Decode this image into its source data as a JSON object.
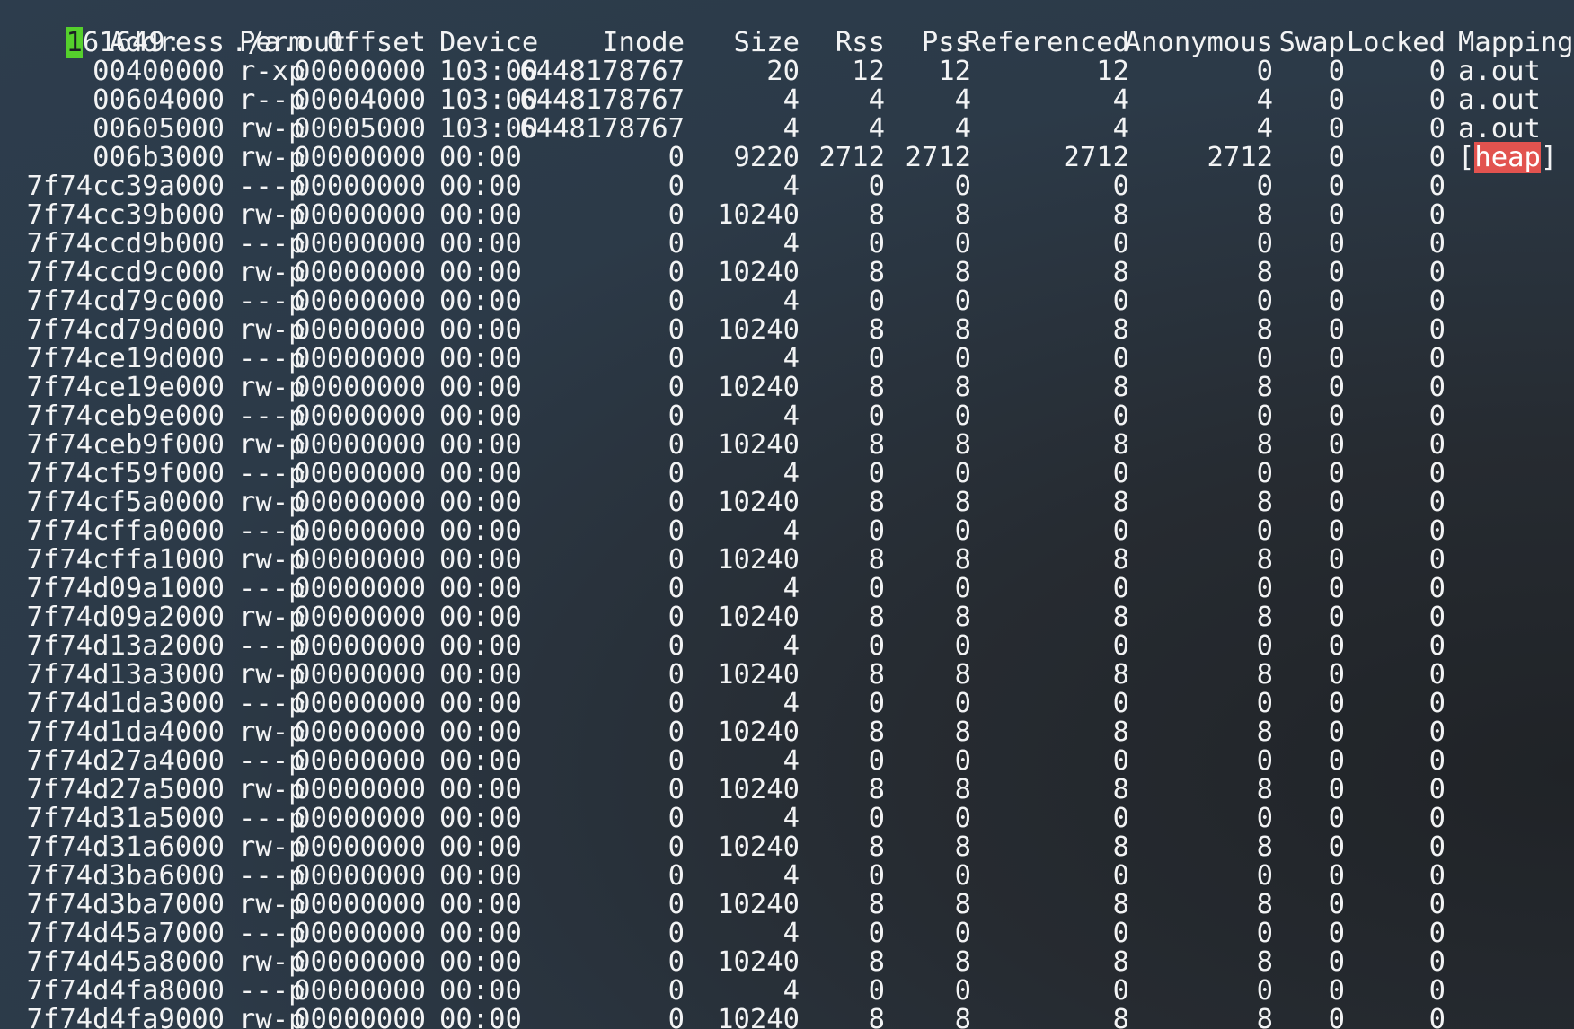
{
  "title_line": {
    "cursor_char": "1",
    "pid_rest": "61649:",
    "command": "./a.out"
  },
  "headers": [
    "Address",
    "Perm",
    "Offset",
    "Device",
    "Inode",
    "Size",
    "Rss",
    "Pss",
    "Referenced",
    "Anonymous",
    "Swap",
    "Locked",
    "Mapping"
  ],
  "rows": [
    [
      "00400000",
      "r-xp",
      "00000000",
      "103:00",
      "6448178767",
      "20",
      "12",
      "12",
      "12",
      "0",
      "0",
      "0",
      "a.out"
    ],
    [
      "00604000",
      "r--p",
      "00004000",
      "103:00",
      "6448178767",
      "4",
      "4",
      "4",
      "4",
      "4",
      "0",
      "0",
      "a.out"
    ],
    [
      "00605000",
      "rw-p",
      "00005000",
      "103:00",
      "6448178767",
      "4",
      "4",
      "4",
      "4",
      "4",
      "0",
      "0",
      "a.out"
    ],
    [
      "006b3000",
      "rw-p",
      "00000000",
      "00:00",
      "0",
      "9220",
      "2712",
      "2712",
      "2712",
      "2712",
      "0",
      "0",
      "[heap]"
    ],
    [
      "7f74cc39a000",
      "---p",
      "00000000",
      "00:00",
      "0",
      "4",
      "0",
      "0",
      "0",
      "0",
      "0",
      "0",
      ""
    ],
    [
      "7f74cc39b000",
      "rw-p",
      "00000000",
      "00:00",
      "0",
      "10240",
      "8",
      "8",
      "8",
      "8",
      "0",
      "0",
      ""
    ],
    [
      "7f74ccd9b000",
      "---p",
      "00000000",
      "00:00",
      "0",
      "4",
      "0",
      "0",
      "0",
      "0",
      "0",
      "0",
      ""
    ],
    [
      "7f74ccd9c000",
      "rw-p",
      "00000000",
      "00:00",
      "0",
      "10240",
      "8",
      "8",
      "8",
      "8",
      "0",
      "0",
      ""
    ],
    [
      "7f74cd79c000",
      "---p",
      "00000000",
      "00:00",
      "0",
      "4",
      "0",
      "0",
      "0",
      "0",
      "0",
      "0",
      ""
    ],
    [
      "7f74cd79d000",
      "rw-p",
      "00000000",
      "00:00",
      "0",
      "10240",
      "8",
      "8",
      "8",
      "8",
      "0",
      "0",
      ""
    ],
    [
      "7f74ce19d000",
      "---p",
      "00000000",
      "00:00",
      "0",
      "4",
      "0",
      "0",
      "0",
      "0",
      "0",
      "0",
      ""
    ],
    [
      "7f74ce19e000",
      "rw-p",
      "00000000",
      "00:00",
      "0",
      "10240",
      "8",
      "8",
      "8",
      "8",
      "0",
      "0",
      ""
    ],
    [
      "7f74ceb9e000",
      "---p",
      "00000000",
      "00:00",
      "0",
      "4",
      "0",
      "0",
      "0",
      "0",
      "0",
      "0",
      ""
    ],
    [
      "7f74ceb9f000",
      "rw-p",
      "00000000",
      "00:00",
      "0",
      "10240",
      "8",
      "8",
      "8",
      "8",
      "0",
      "0",
      ""
    ],
    [
      "7f74cf59f000",
      "---p",
      "00000000",
      "00:00",
      "0",
      "4",
      "0",
      "0",
      "0",
      "0",
      "0",
      "0",
      ""
    ],
    [
      "7f74cf5a0000",
      "rw-p",
      "00000000",
      "00:00",
      "0",
      "10240",
      "8",
      "8",
      "8",
      "8",
      "0",
      "0",
      ""
    ],
    [
      "7f74cffa0000",
      "---p",
      "00000000",
      "00:00",
      "0",
      "4",
      "0",
      "0",
      "0",
      "0",
      "0",
      "0",
      ""
    ],
    [
      "7f74cffa1000",
      "rw-p",
      "00000000",
      "00:00",
      "0",
      "10240",
      "8",
      "8",
      "8",
      "8",
      "0",
      "0",
      ""
    ],
    [
      "7f74d09a1000",
      "---p",
      "00000000",
      "00:00",
      "0",
      "4",
      "0",
      "0",
      "0",
      "0",
      "0",
      "0",
      ""
    ],
    [
      "7f74d09a2000",
      "rw-p",
      "00000000",
      "00:00",
      "0",
      "10240",
      "8",
      "8",
      "8",
      "8",
      "0",
      "0",
      ""
    ],
    [
      "7f74d13a2000",
      "---p",
      "00000000",
      "00:00",
      "0",
      "4",
      "0",
      "0",
      "0",
      "0",
      "0",
      "0",
      ""
    ],
    [
      "7f74d13a3000",
      "rw-p",
      "00000000",
      "00:00",
      "0",
      "10240",
      "8",
      "8",
      "8",
      "8",
      "0",
      "0",
      ""
    ],
    [
      "7f74d1da3000",
      "---p",
      "00000000",
      "00:00",
      "0",
      "4",
      "0",
      "0",
      "0",
      "0",
      "0",
      "0",
      ""
    ],
    [
      "7f74d1da4000",
      "rw-p",
      "00000000",
      "00:00",
      "0",
      "10240",
      "8",
      "8",
      "8",
      "8",
      "0",
      "0",
      ""
    ],
    [
      "7f74d27a4000",
      "---p",
      "00000000",
      "00:00",
      "0",
      "4",
      "0",
      "0",
      "0",
      "0",
      "0",
      "0",
      ""
    ],
    [
      "7f74d27a5000",
      "rw-p",
      "00000000",
      "00:00",
      "0",
      "10240",
      "8",
      "8",
      "8",
      "8",
      "0",
      "0",
      ""
    ],
    [
      "7f74d31a5000",
      "---p",
      "00000000",
      "00:00",
      "0",
      "4",
      "0",
      "0",
      "0",
      "0",
      "0",
      "0",
      ""
    ],
    [
      "7f74d31a6000",
      "rw-p",
      "00000000",
      "00:00",
      "0",
      "10240",
      "8",
      "8",
      "8",
      "8",
      "0",
      "0",
      ""
    ],
    [
      "7f74d3ba6000",
      "---p",
      "00000000",
      "00:00",
      "0",
      "4",
      "0",
      "0",
      "0",
      "0",
      "0",
      "0",
      ""
    ],
    [
      "7f74d3ba7000",
      "rw-p",
      "00000000",
      "00:00",
      "0",
      "10240",
      "8",
      "8",
      "8",
      "8",
      "0",
      "0",
      ""
    ],
    [
      "7f74d45a7000",
      "---p",
      "00000000",
      "00:00",
      "0",
      "4",
      "0",
      "0",
      "0",
      "0",
      "0",
      "0",
      ""
    ],
    [
      "7f74d45a8000",
      "rw-p",
      "00000000",
      "00:00",
      "0",
      "10240",
      "8",
      "8",
      "8",
      "8",
      "0",
      "0",
      ""
    ],
    [
      "7f74d4fa8000",
      "---p",
      "00000000",
      "00:00",
      "0",
      "4",
      "0",
      "0",
      "0",
      "0",
      "0",
      "0",
      ""
    ],
    [
      "7f74d4fa9000",
      "rw-p",
      "00000000",
      "00:00",
      "0",
      "10240",
      "8",
      "8",
      "8",
      "8",
      "0",
      "0",
      ""
    ]
  ],
  "colors": {
    "cursor": "#55d02c",
    "heap_highlight": "#e2534f",
    "text": "#f2f3f4"
  }
}
